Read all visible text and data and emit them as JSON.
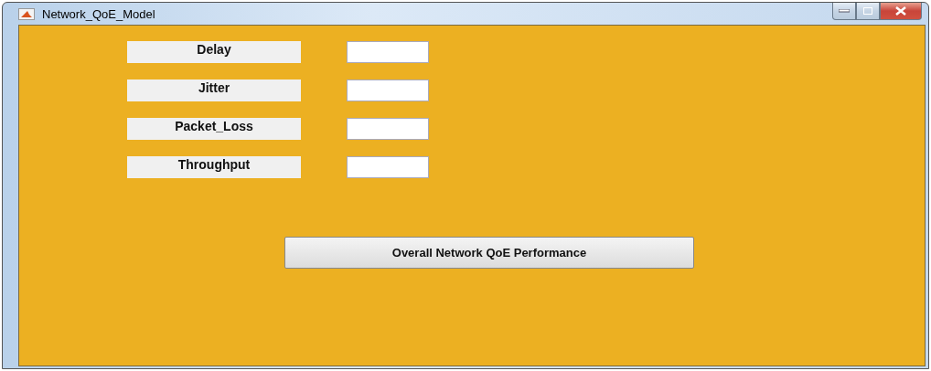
{
  "window": {
    "title": "Network_QoE_Model"
  },
  "inputs": [
    {
      "label": "Delay"
    },
    {
      "label": "Jitter"
    },
    {
      "label": "Packet_Loss"
    },
    {
      "label": "Throughput"
    }
  ],
  "button": {
    "label": "Overall Network QoE Performance"
  }
}
